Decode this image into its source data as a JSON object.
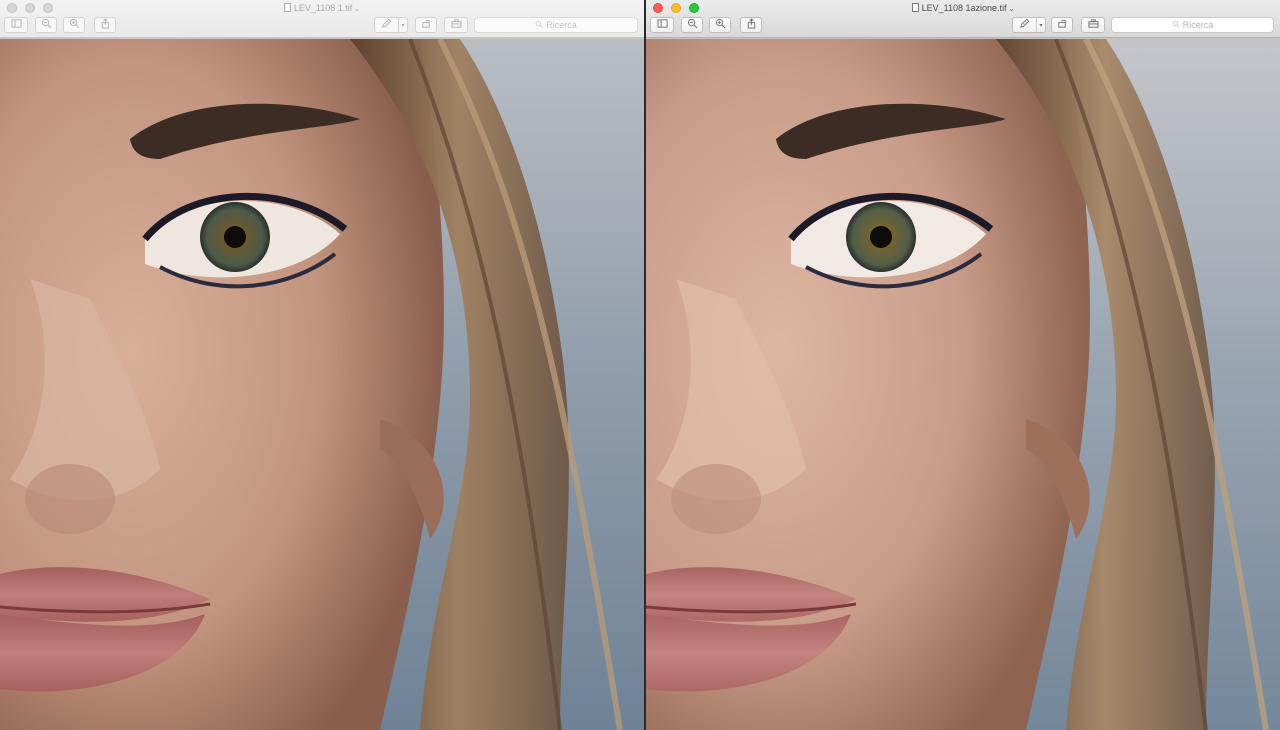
{
  "windows": [
    {
      "id": "left",
      "state": "inactive",
      "title": "LEV_1108 1.tif",
      "search_placeholder": "Ricerca",
      "photo_description": "close-up portrait of woman, original",
      "icons": [
        "sidebar-icon",
        "zoom-out-icon",
        "zoom-in-icon",
        "share-icon",
        "markup-pen-icon",
        "rotate-icon",
        "toolbox-icon",
        "search-icon"
      ]
    },
    {
      "id": "right",
      "state": "active",
      "title": "LEV_1108 1azione.tif",
      "search_placeholder": "Ricerca",
      "photo_description": "close-up portrait of woman, retouched",
      "icons": [
        "sidebar-icon",
        "zoom-out-icon",
        "zoom-in-icon",
        "share-icon",
        "markup-pen-icon",
        "rotate-icon",
        "toolbox-icon",
        "search-icon"
      ]
    }
  ],
  "colors": {
    "skin": "#c99e86",
    "skin_shadow": "#a67560",
    "hair": "#8a6a4e",
    "background": "#9aa6b4",
    "lips": "#b06e6a",
    "iris": "#5e5a3a",
    "traffic_close": "#fc5f57",
    "traffic_min": "#fdbc2e",
    "traffic_max": "#28c840"
  }
}
